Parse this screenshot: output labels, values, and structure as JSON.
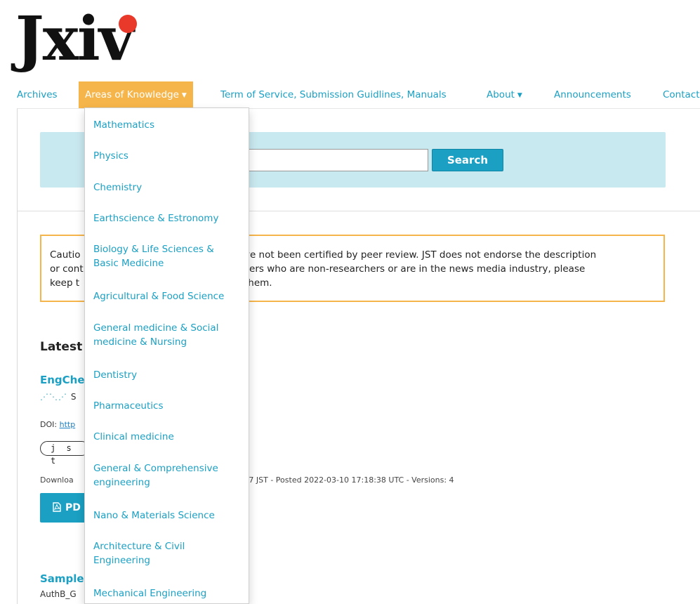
{
  "logo": {
    "text": "Jxiv"
  },
  "nav": {
    "archives": "Archives",
    "areas": "Areas of Knowledge",
    "terms": "Term of Service, Submission Guidlines, Manuals",
    "about": "About",
    "announcements": "Announcements",
    "contact": "Contact",
    "caret": "▼"
  },
  "search": {
    "value": "",
    "button_label": "Search"
  },
  "caution": {
    "line1_start": "Cautio",
    "line1_end": "t have not been certified by peer review. JST does not endorse the description",
    "line2_start": "or cont",
    "line2_end": "readers who are non-researchers or are in the news media industry, please",
    "line3_start": "keep t",
    "line3_end": "g them."
  },
  "latest": {
    "heading_partial": "Latest"
  },
  "article": {
    "title_partial": "EngChe",
    "authors_partial": "S",
    "doi_label": "DOI:",
    "doi_link_partial": "http",
    "tag_partial": "j s t",
    "stats_start": "Downloa",
    "stats_end": "9:47 JST - Posted 2022-03-10 17:18:38 UTC -  Versions: 4",
    "pdf_label_partial": "PD"
  },
  "sample": {
    "title_partial": "Sample",
    "authors_partial": "AuthB_G"
  },
  "dropdown": {
    "items": [
      {
        "line1": "Mathematics",
        "line2": ""
      },
      {
        "line1": "Physics",
        "line2": ""
      },
      {
        "line1": "Chemistry",
        "line2": ""
      },
      {
        "line1": "Earthscience & Estronomy",
        "line2": ""
      },
      {
        "line1": "Biology & Life Sciences &",
        "line2": "Basic Medicine"
      },
      {
        "line1": "Agricultural & Food Science",
        "line2": ""
      },
      {
        "line1": "General medicine & Social",
        "line2": "medicine & Nursing"
      },
      {
        "line1": "Dentistry",
        "line2": ""
      },
      {
        "line1": "Pharmaceutics",
        "line2": ""
      },
      {
        "line1": "Clinical medicine",
        "line2": ""
      },
      {
        "line1": "General & Comprehensive",
        "line2": "engineering"
      },
      {
        "line1": "Nano & Materials Science",
        "line2": ""
      },
      {
        "line1": "Architecture & Civil",
        "line2": "Engineering"
      },
      {
        "line1": "Mechanical Engineering",
        "line2": ""
      }
    ]
  },
  "colors": {
    "accent": "#1ba0c3",
    "active_nav": "#f6b54a",
    "logo_dot": "#e8392a",
    "search_bg": "#c9e9f0"
  }
}
